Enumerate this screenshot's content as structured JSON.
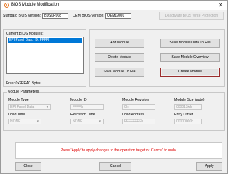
{
  "window": {
    "title": "BIOS Module Modification"
  },
  "header": {
    "standard_label": "Standard BIOS Version:",
    "standard_value": "BDSLR008",
    "oem_label": "OEM BIOS Version:",
    "oem_value": "OEM19001",
    "deactivate_label": "Deactivate BIOS Write Protection"
  },
  "modules": {
    "title": "Current BIOS Modules:",
    "items": [
      "EPI Panel Data, ID: FFFFh"
    ],
    "free_text": "Free: 0x2EEA0 Bytes"
  },
  "actions": {
    "add": "Add Module",
    "save_to_file": "Save Module Data To File",
    "delete": "Delete Module",
    "overview": "Save Module Overview",
    "save_file": "Save Module To File",
    "create": "Create Module"
  },
  "params": {
    "title": "Module Parameters",
    "type_label": "Module Type",
    "type_value": "EPI Panel Data",
    "id_label": "Module ID",
    "id_value": "FFFFh",
    "rev_label": "Module Revision",
    "rev_value": "0h",
    "size_label": "Module Size (auto)",
    "size_value": "000013Ah",
    "load_time_label": "Load Time",
    "load_time_value": "NONE",
    "exec_time_label": "Execution Time",
    "exec_time_value": "NONE",
    "load_addr_label": "Load Address",
    "load_addr_value": "FFFFFFFFh",
    "entry_label": "Entry Offset",
    "entry_value": "00000000h"
  },
  "status": {
    "message": "Press 'Apply' to apply changes to the operation target or 'Cancel' to undo."
  },
  "footer": {
    "close": "Close",
    "cancel": "Cancel",
    "apply": "Apply"
  },
  "colors": {
    "accent": "#0078d7",
    "warning": "#e00000",
    "focus_border": "#9b2d2d",
    "icon": "#e87722"
  }
}
